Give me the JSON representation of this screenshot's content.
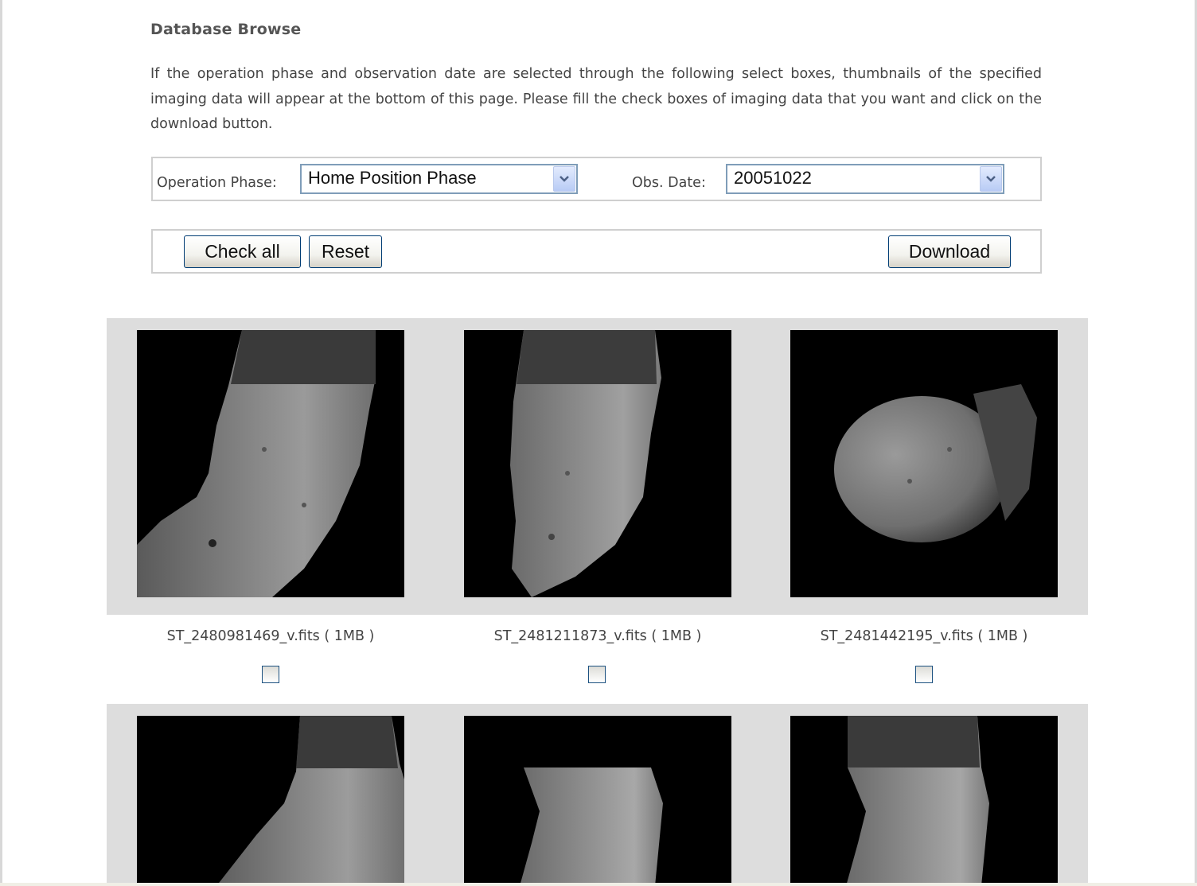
{
  "page": {
    "title": "Database Browse",
    "intro": "If the operation phase and observation date are selected through the following select boxes, thumbnails of the specified imaging data will appear at the bottom of this page. Please fill the check boxes of imaging data that you want and click on the download button."
  },
  "filters": {
    "phase_label": "Operation Phase:",
    "phase_value": "Home Position Phase",
    "date_label": "Obs. Date:",
    "date_value": "20051022"
  },
  "actions": {
    "check_all": "Check all",
    "reset": "Reset",
    "download": "Download"
  },
  "images": [
    {
      "filename": "ST_2480981469_v.fits ( 1MB )",
      "checked": false
    },
    {
      "filename": "ST_2481211873_v.fits ( 1MB )",
      "checked": false
    },
    {
      "filename": "ST_2481442195_v.fits ( 1MB )",
      "checked": false
    },
    {
      "filename": "",
      "checked": false
    },
    {
      "filename": "",
      "checked": false
    },
    {
      "filename": "",
      "checked": false
    }
  ],
  "icons": {
    "dropdown": "chevron-down-icon"
  },
  "colors": {
    "strip_bg": "#dddddd",
    "select_border": "#7f9db9",
    "button_border": "#003c74"
  }
}
